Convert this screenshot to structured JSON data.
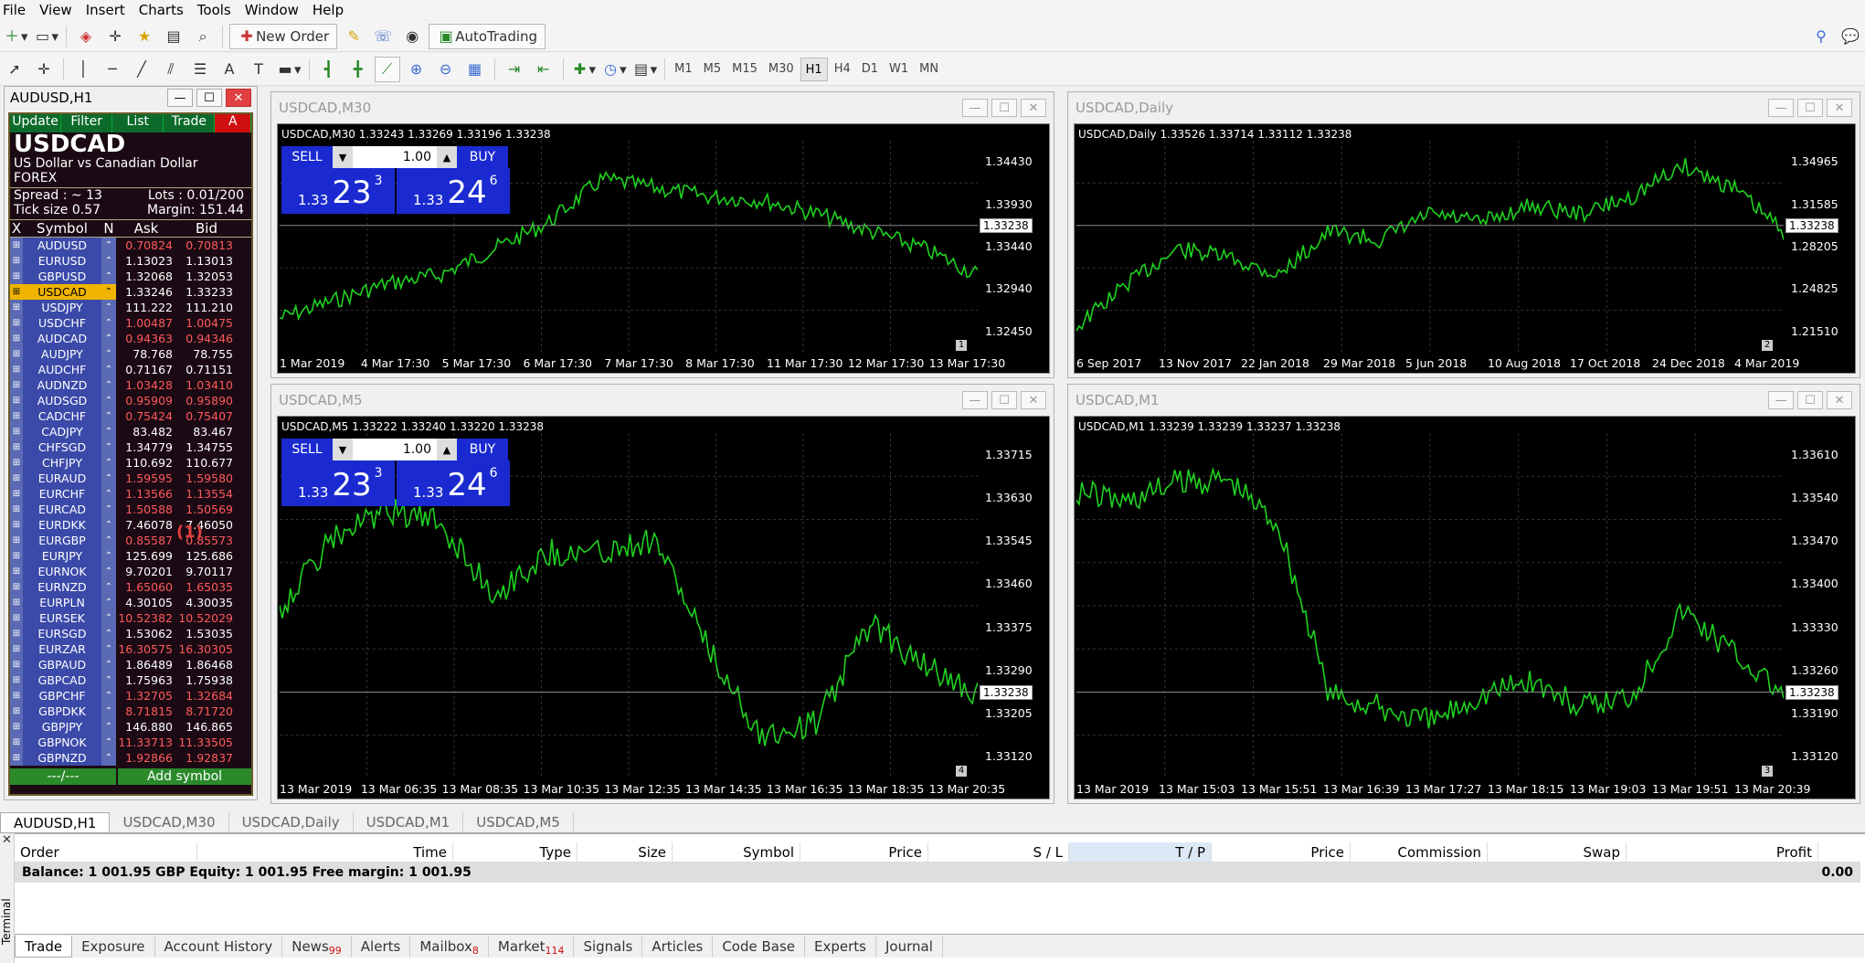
{
  "menu": [
    "File",
    "View",
    "Insert",
    "Charts",
    "Tools",
    "Window",
    "Help"
  ],
  "toolbar": {
    "new_order": "New Order",
    "autotrading": "AutoTrading"
  },
  "timeframes": [
    "M1",
    "M5",
    "M15",
    "M30",
    "H1",
    "H4",
    "D1",
    "W1",
    "MN"
  ],
  "timeframe_active": "H1",
  "left_window": {
    "title": "AUDUSD,H1",
    "tabs": [
      "Update",
      "Filter",
      "List",
      "Trade",
      "A"
    ],
    "symbol": "USDCAD",
    "desc": "US Dollar vs Canadian Dollar",
    "type": "FOREX",
    "spread": "Spread : ~ 13",
    "lots": "Lots    : 0.01/200",
    "ticksize": "Tick size 0.57",
    "margin": "Margin: 151.44",
    "hdr": {
      "x": "X",
      "symbol": "Symbol",
      "n": "N",
      "ask": "Ask",
      "bid": "Bid"
    },
    "rows": [
      [
        "AUDUSD",
        "0.70824",
        "0.70813"
      ],
      [
        "EURUSD",
        "1.13023",
        "1.13013"
      ],
      [
        "GBPUSD",
        "1.32068",
        "1.32053"
      ],
      [
        "USDCAD",
        "1.33246",
        "1.33233"
      ],
      [
        "USDJPY",
        "111.222",
        "111.210"
      ],
      [
        "USDCHF",
        "1.00487",
        "1.00475"
      ],
      [
        "AUDCAD",
        "0.94363",
        "0.94346"
      ],
      [
        "AUDJPY",
        "78.768",
        "78.755"
      ],
      [
        "AUDCHF",
        "0.71167",
        "0.71151"
      ],
      [
        "AUDNZD",
        "1.03428",
        "1.03410"
      ],
      [
        "AUDSGD",
        "0.95909",
        "0.95890"
      ],
      [
        "CADCHF",
        "0.75424",
        "0.75407"
      ],
      [
        "CADJPY",
        "83.482",
        "83.467"
      ],
      [
        "CHFSGD",
        "1.34779",
        "1.34755"
      ],
      [
        "CHFJPY",
        "110.692",
        "110.677"
      ],
      [
        "EURAUD",
        "1.59595",
        "1.59580"
      ],
      [
        "EURCHF",
        "1.13566",
        "1.13554"
      ],
      [
        "EURCAD",
        "1.50588",
        "1.50569"
      ],
      [
        "EURDKK",
        "7.46078",
        "7.46050"
      ],
      [
        "EURGBP",
        "0.85587",
        "0.85573"
      ],
      [
        "EURJPY",
        "125.699",
        "125.686"
      ],
      [
        "EURNOK",
        "9.70201",
        "9.70117"
      ],
      [
        "EURNZD",
        "1.65060",
        "1.65035"
      ],
      [
        "EURPLN",
        "4.30105",
        "4.30035"
      ],
      [
        "EURSEK",
        "10.52382",
        "10.52029"
      ],
      [
        "EURSGD",
        "1.53062",
        "1.53035"
      ],
      [
        "EURZAR",
        "16.30575",
        "16.30305"
      ],
      [
        "GBPAUD",
        "1.86489",
        "1.86468"
      ],
      [
        "GBPCAD",
        "1.75963",
        "1.75938"
      ],
      [
        "GBPCHF",
        "1.32705",
        "1.32684"
      ],
      [
        "GBPDKK",
        "8.71815",
        "8.71720"
      ],
      [
        "GBPJPY",
        "146.880",
        "146.865"
      ],
      [
        "GBPNOK",
        "11.33713",
        "11.33505"
      ],
      [
        "GBPNZD",
        "1.92866",
        "1.92837"
      ]
    ],
    "footer_left": "---/---",
    "footer_add": "Add symbol",
    "marker": "(1)"
  },
  "charts": [
    {
      "title": "USDCAD,M30",
      "ohlc": "USDCAD,M30  1.33243 1.33269 1.33196 1.33238",
      "lot": "1.00",
      "sell": "SELL",
      "buy": "BUY",
      "bid_small": "1.33",
      "bid_big": "23",
      "bid_sup": "3",
      "ask_small": "1.33",
      "ask_big": "24",
      "ask_sup": "6",
      "price": "1.33238",
      "badge": "1",
      "y": [
        "1.34430",
        "1.33930",
        "1.33440",
        "1.32940",
        "1.32450"
      ],
      "x": [
        "1 Mar 2019",
        "4 Mar 17:30",
        "5 Mar 17:30",
        "6 Mar 17:30",
        "7 Mar 17:30",
        "8 Mar 17:30",
        "11 Mar 17:30",
        "12 Mar 17:30",
        "13 Mar 17:30"
      ]
    },
    {
      "title": "USDCAD,Daily",
      "ohlc": "USDCAD,Daily  1.33526 1.33714 1.33112 1.33238",
      "price": "1.33238",
      "badge": "2",
      "y": [
        "1.34965",
        "1.31585",
        "1.28205",
        "1.24825",
        "1.21510"
      ],
      "x": [
        "6 Sep 2017",
        "13 Nov 2017",
        "22 Jan 2018",
        "29 Mar 2018",
        "5 Jun 2018",
        "10 Aug 2018",
        "17 Oct 2018",
        "24 Dec 2018",
        "4 Mar 2019"
      ]
    },
    {
      "title": "USDCAD,M5",
      "ohlc": "USDCAD,M5  1.33222 1.33240 1.33220 1.33238",
      "lot": "1.00",
      "sell": "SELL",
      "buy": "BUY",
      "bid_small": "1.33",
      "bid_big": "23",
      "bid_sup": "3",
      "ask_small": "1.33",
      "ask_big": "24",
      "ask_sup": "6",
      "price": "1.33238",
      "badge": "4",
      "y": [
        "1.33715",
        "1.33630",
        "1.33545",
        "1.33460",
        "1.33375",
        "1.33290",
        "1.33205",
        "1.33120"
      ],
      "x": [
        "13 Mar 2019",
        "13 Mar 06:35",
        "13 Mar 08:35",
        "13 Mar 10:35",
        "13 Mar 12:35",
        "13 Mar 14:35",
        "13 Mar 16:35",
        "13 Mar 18:35",
        "13 Mar 20:35"
      ]
    },
    {
      "title": "USDCAD,M1",
      "ohlc": "USDCAD,M1  1.33239 1.33239 1.33237 1.33238",
      "price": "1.33238",
      "badge": "3",
      "y": [
        "1.33610",
        "1.33540",
        "1.33470",
        "1.33400",
        "1.33330",
        "1.33260",
        "1.33190",
        "1.33120"
      ],
      "x": [
        "13 Mar 2019",
        "13 Mar 15:03",
        "13 Mar 15:51",
        "13 Mar 16:39",
        "13 Mar 17:27",
        "13 Mar 18:15",
        "13 Mar 19:03",
        "13 Mar 19:51",
        "13 Mar 20:39"
      ]
    }
  ],
  "chart_tabs": [
    "AUDUSD,H1",
    "USDCAD,M30",
    "USDCAD,Daily",
    "USDCAD,M1",
    "USDCAD,M5"
  ],
  "terminal": {
    "side_label": "Terminal",
    "cols": [
      "Order",
      "Time",
      "Type",
      "Size",
      "Symbol",
      "Price",
      "S / L",
      "T / P",
      "Price",
      "Commission",
      "Swap",
      "Profit"
    ],
    "balance": "Balance: 1 001.95 GBP  Equity: 1 001.95  Free margin: 1 001.95",
    "profit": "0.00",
    "tabs": [
      {
        "label": "Trade"
      },
      {
        "label": "Exposure"
      },
      {
        "label": "Account History"
      },
      {
        "label": "News",
        "badge": "99"
      },
      {
        "label": "Alerts"
      },
      {
        "label": "Mailbox",
        "badge": "8"
      },
      {
        "label": "Market",
        "badge": "114"
      },
      {
        "label": "Signals"
      },
      {
        "label": "Articles"
      },
      {
        "label": "Code Base"
      },
      {
        "label": "Experts"
      },
      {
        "label": "Journal"
      }
    ]
  }
}
